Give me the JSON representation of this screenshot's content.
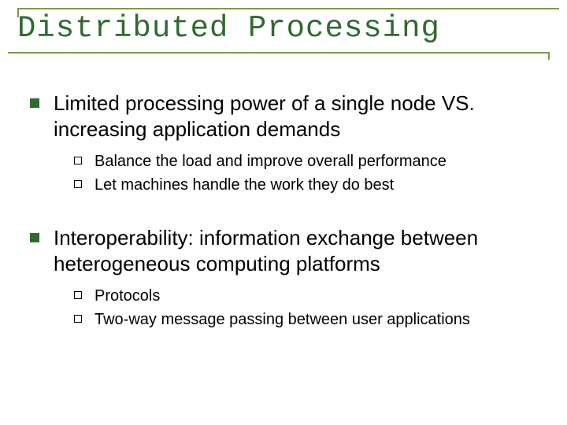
{
  "title": "Distributed Processing",
  "points": [
    {
      "text": "Limited processing power of a single node VS. increasing application demands",
      "sub": [
        "Balance the load and improve overall performance",
        "Let machines handle the work they do best"
      ]
    },
    {
      "text": "Interoperability: information exchange between heterogeneous computing platforms",
      "sub": [
        "Protocols",
        "Two-way message passing between user applications"
      ]
    }
  ]
}
